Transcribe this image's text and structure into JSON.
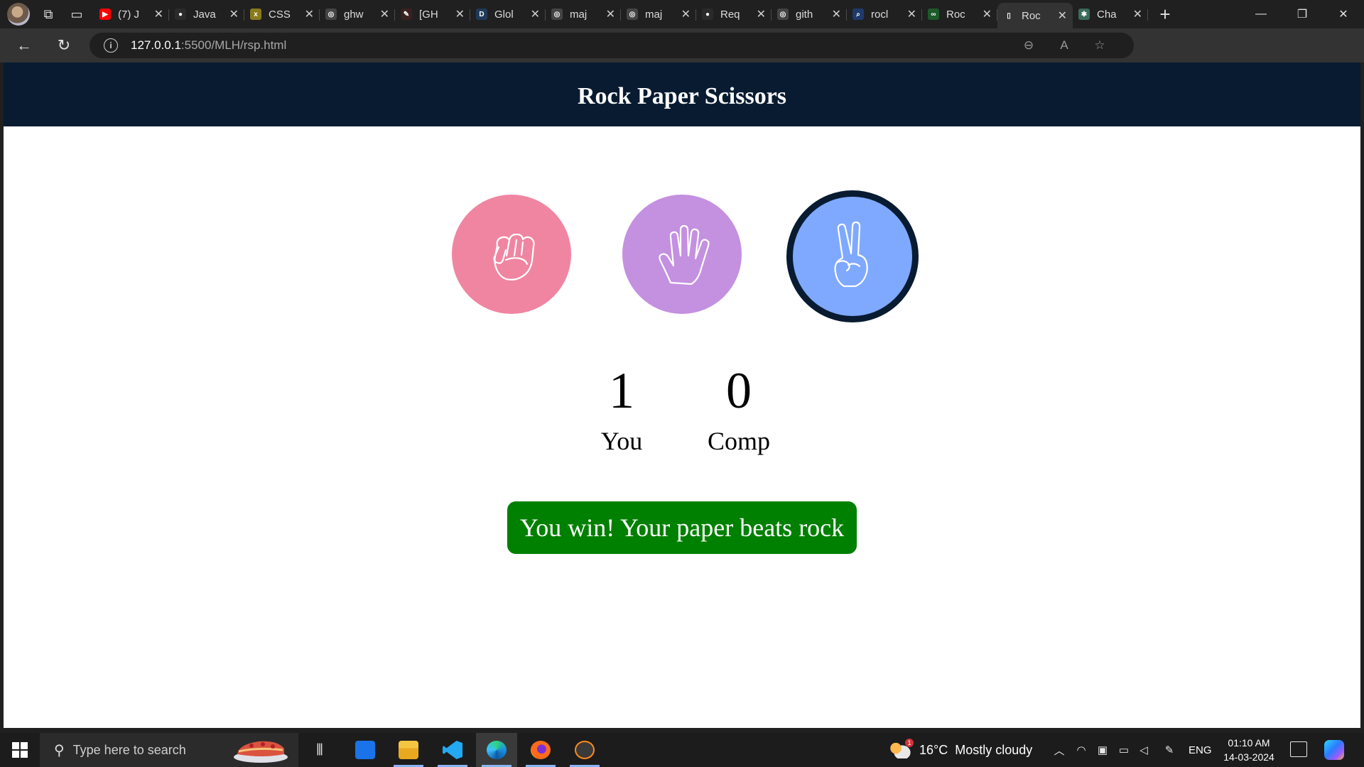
{
  "browser": {
    "tabs": [
      {
        "title": "(7) J",
        "favicon_color": "#ff0000",
        "favicon_glyph": "▶"
      },
      {
        "title": "Java",
        "favicon_color": "#2b2b2b",
        "favicon_glyph": "●"
      },
      {
        "title": "CSS",
        "favicon_color": "#8a7a1a",
        "favicon_glyph": "x"
      },
      {
        "title": "ghw",
        "favicon_color": "#444444",
        "favicon_glyph": "◎"
      },
      {
        "title": "[GH",
        "favicon_color": "#3a2020",
        "favicon_glyph": "✎"
      },
      {
        "title": "Glol",
        "favicon_color": "#1f3a5a",
        "favicon_glyph": "D"
      },
      {
        "title": "maj",
        "favicon_color": "#444444",
        "favicon_glyph": "◎"
      },
      {
        "title": "maj",
        "favicon_color": "#444444",
        "favicon_glyph": "◎"
      },
      {
        "title": "Req",
        "favicon_color": "#2b2b2b",
        "favicon_glyph": "●"
      },
      {
        "title": "gith",
        "favicon_color": "#444444",
        "favicon_glyph": "◎"
      },
      {
        "title": "rocl",
        "favicon_color": "#1f3a6a",
        "favicon_glyph": "⌕"
      },
      {
        "title": "Roc",
        "favicon_color": "#1d5a2a",
        "favicon_glyph": "∞"
      },
      {
        "title": "Roc",
        "favicon_color": "#333333",
        "favicon_glyph": "▯",
        "active": true
      },
      {
        "title": "Cha",
        "favicon_color": "#3a6a5a",
        "favicon_glyph": "✱"
      }
    ],
    "url_host": "127.0.0.1",
    "url_path": ":5500/MLH/rsp.html"
  },
  "game": {
    "title": "Rock Paper Scissors",
    "choices": [
      {
        "id": "rock",
        "color": "#f085a2"
      },
      {
        "id": "paper",
        "color": "#c490e0"
      },
      {
        "id": "scissors",
        "color": "#7fa9ff",
        "selected": true
      }
    ],
    "user_score": "1",
    "user_label": "You",
    "comp_score": "0",
    "comp_label": "Comp",
    "result_message": "You win! Your paper beats rock",
    "result_color": "#008000",
    "header_color": "#081b31"
  },
  "taskbar": {
    "search_placeholder": "Type here to search",
    "weather_temp": "16°C",
    "weather_desc": "Mostly cloudy",
    "weather_badge": "1",
    "language": "ENG",
    "time": "01:10 AM",
    "date": "14-03-2024",
    "apps": [
      "task-view",
      "mail",
      "file-explorer",
      "vscode",
      "edge",
      "firefox",
      "sublime"
    ]
  }
}
